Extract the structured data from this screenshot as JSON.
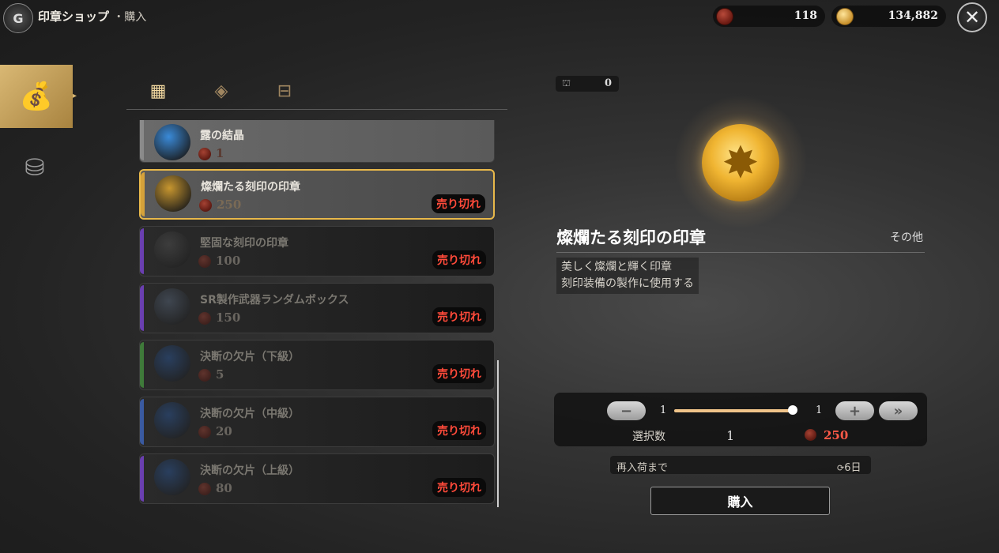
{
  "header": {
    "logo_letter": "G",
    "title": "印章ショップ",
    "subtitle": "・購入",
    "currencies": [
      {
        "icon": "red-seal-coin-icon",
        "value": "118"
      },
      {
        "icon": "gold-coin-icon",
        "value": "134,882"
      }
    ],
    "close_icon": "close-icon"
  },
  "side_nav": [
    {
      "icon": "money-bag-icon",
      "active": true
    },
    {
      "icon": "coin-stack-icon",
      "active": false
    }
  ],
  "tabs": [
    {
      "icon": "grid-icon",
      "active": true
    },
    {
      "icon": "pouch-icon",
      "active": false
    },
    {
      "icon": "chest-icon",
      "active": false
    }
  ],
  "items": [
    {
      "name": "露の結晶",
      "price": "1",
      "sold_out": "",
      "edge_color": "#8a8a8a",
      "icon_color": "#3a8ad8",
      "dim": false,
      "partial": true
    },
    {
      "name": "燦爛たる刻印の印章",
      "price": "250",
      "sold_out": "売り切れ",
      "edge_color": "#d6a23a",
      "icon_color": "#c7962f",
      "dim": false,
      "selected": true
    },
    {
      "name": "堅固な刻印の印章",
      "price": "100",
      "sold_out": "売り切れ",
      "edge_color": "#6a3fb0",
      "icon_color": "#555555",
      "dim": true
    },
    {
      "name": "SR製作武器ランダムボックス",
      "price": "150",
      "sold_out": "売り切れ",
      "edge_color": "#6a3fb0",
      "icon_color": "#5a6a80",
      "dim": true
    },
    {
      "name": "決断の欠片（下級）",
      "price": "5",
      "sold_out": "売り切れ",
      "edge_color": "#3f7a3a",
      "icon_color": "#2a5aa0",
      "dim": true
    },
    {
      "name": "決断の欠片（中級）",
      "price": "20",
      "sold_out": "売り切れ",
      "edge_color": "#3a5aa0",
      "icon_color": "#2a5aa0",
      "dim": true
    },
    {
      "name": "決断の欠片（上級）",
      "price": "80",
      "sold_out": "売り切れ",
      "edge_color": "#6a3fb0",
      "icon_color": "#2a5aa0",
      "dim": true
    }
  ],
  "detail": {
    "owned_count": "0",
    "name": "燦爛たる刻印の印章",
    "category": "その他",
    "description": [
      "美しく燦爛と輝く印章",
      "刻印装備の製作に使用する"
    ]
  },
  "quantity": {
    "minus_label": "−",
    "plus_label": "+",
    "max_label": "»",
    "min": "1",
    "max": "1",
    "slider_fraction": 1.0,
    "selected_label": "選択数",
    "selected_value": "1",
    "total_price": "250"
  },
  "restock": {
    "label": "再入荷まで",
    "value": "6日"
  },
  "buy_label": "購入"
}
